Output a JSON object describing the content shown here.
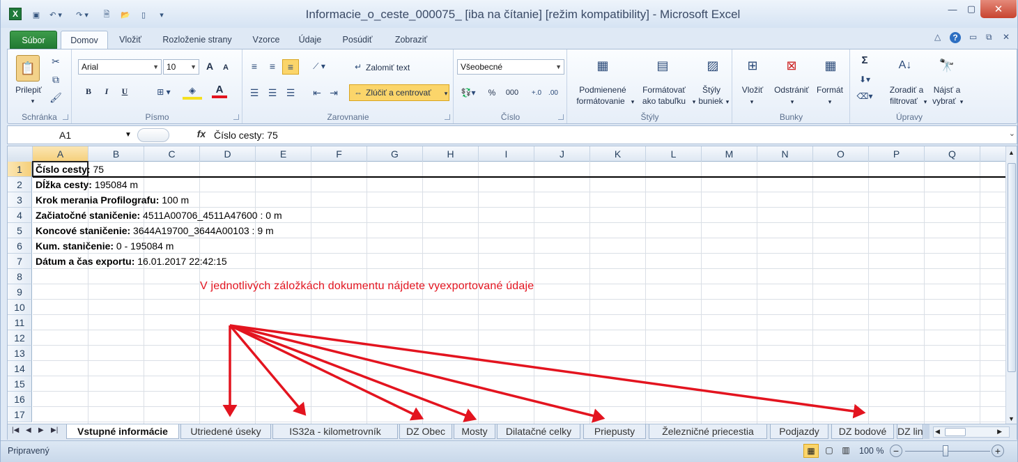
{
  "window": {
    "title": "Informacie_o_ceste_000075_  [iba na čítanie]  [režim kompatibility]  -  Microsoft Excel",
    "app_icon": "X"
  },
  "tabs": [
    {
      "label": "Súbor"
    },
    {
      "label": "Domov"
    },
    {
      "label": "Vložiť"
    },
    {
      "label": "Rozloženie strany"
    },
    {
      "label": "Vzorce"
    },
    {
      "label": "Údaje"
    },
    {
      "label": "Posúdiť"
    },
    {
      "label": "Zobraziť"
    }
  ],
  "ribbon": {
    "clipboard": {
      "group": "Schránka",
      "paste": "Prilepiť"
    },
    "font": {
      "group": "Písmo",
      "font_name": "Arial",
      "font_size": "10",
      "bold": "B",
      "italic": "I",
      "underline": "U",
      "grow": "A",
      "shrink": "A",
      "font_color": "A"
    },
    "alignment": {
      "group": "Zarovnanie",
      "wrap": "Zalomiť text",
      "merge": "Zlúčiť a centrovať"
    },
    "number": {
      "group": "Číslo",
      "format": "Všeobecné",
      "percent": "%",
      "thousands": "000"
    },
    "styles": {
      "group": "Štýly",
      "cond1": "Podmienené",
      "cond2": "formátovanie",
      "table1": "Formátovať",
      "table2": "ako tabuľku",
      "cell1": "Štýly",
      "cell2": "buniek"
    },
    "cells": {
      "group": "Bunky",
      "insert": "Vložiť",
      "delete": "Odstrániť",
      "format": "Formát"
    },
    "editing": {
      "group": "Úpravy",
      "sort1": "Zoradiť a",
      "sort2": "filtrovať",
      "find1": "Nájsť a",
      "find2": "vybrať",
      "sigma": "Σ"
    }
  },
  "formula_bar": {
    "name_box": "A1",
    "fx": "fx",
    "formula": "Číslo cesty: 75"
  },
  "columns": [
    "A",
    "B",
    "C",
    "D",
    "E",
    "F",
    "G",
    "H",
    "I",
    "J",
    "K",
    "L",
    "M",
    "N",
    "O",
    "P",
    "Q"
  ],
  "rows": [
    "1",
    "2",
    "3",
    "4",
    "5",
    "6",
    "7",
    "8",
    "9",
    "10",
    "11",
    "12",
    "13",
    "14",
    "15",
    "16",
    "17"
  ],
  "cells": [
    {
      "label": "Číslo cesty:",
      "value": " 75"
    },
    {
      "label": "Dĺžka cesty:",
      "value": " 195084 m"
    },
    {
      "label": "Krok merania Profilografu:",
      "value": " 100 m"
    },
    {
      "label": "Začiatočné staničenie:",
      "value": " 4511A00706_4511A47600 : 0 m"
    },
    {
      "label": "Koncové staničenie:",
      "value": " 3644A19700_3644A00103 : 9 m"
    },
    {
      "label": "Kum. staničenie:",
      "value": " 0 - 195084 m"
    },
    {
      "label": "Dátum a čas exportu:",
      "value": " 16.01.2017 22:42:15"
    }
  ],
  "annotation": "V jednotlivých záložkách dokumentu nájdete vyexportované údaje",
  "sheets": [
    "Vstupné informácie",
    "Utriedené úseky",
    "IS32a - kilometrovník",
    "DZ Obec",
    "Mosty",
    "Dilatačné celky",
    "Priepusty",
    "Železničné priecestia",
    "Podjazdy",
    "DZ bodové",
    "DZ lin"
  ],
  "status": {
    "ready": "Pripravený",
    "zoom": "100 %"
  },
  "colors": {
    "accent_green": "#217a33",
    "annotation_red": "#e3141f"
  }
}
